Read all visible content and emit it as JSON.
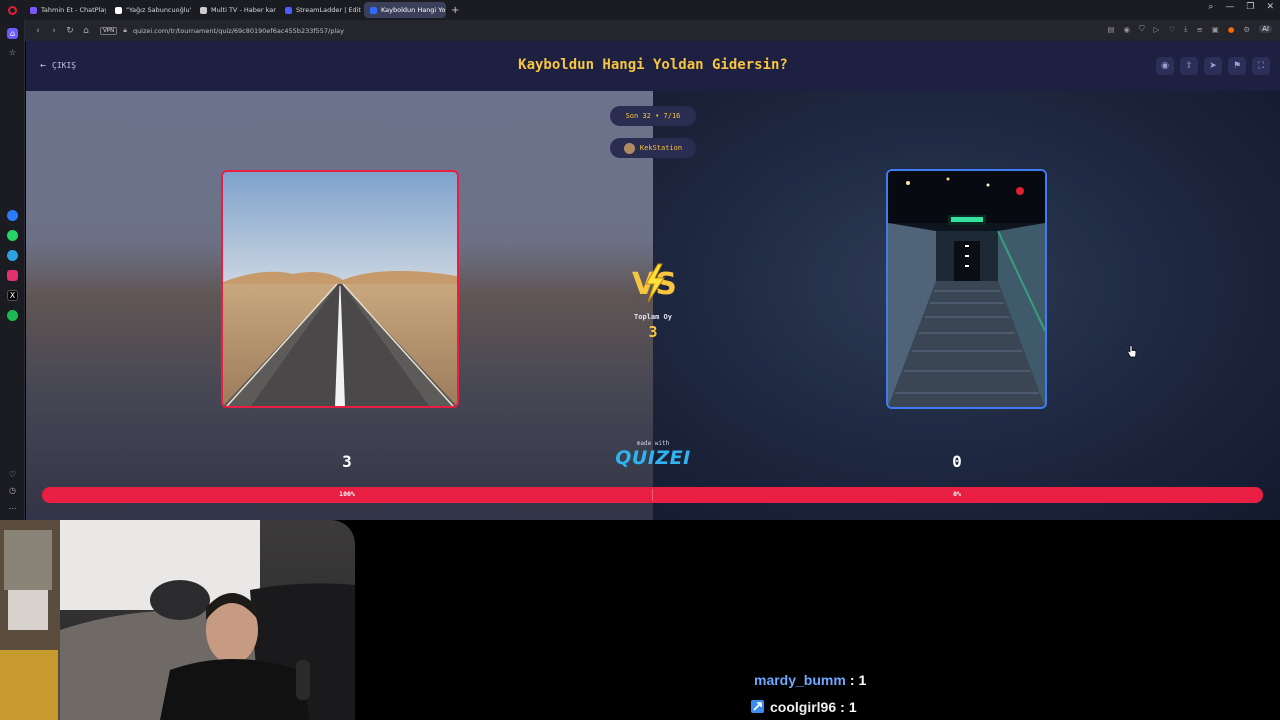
{
  "browser": {
    "tabs": [
      {
        "label": "Tahmin Et - ChatPlay",
        "color": "#7b57ff",
        "active": false
      },
      {
        "label": "\"Yağız Sabuncuoğlu\" - A…",
        "color": "#ffffff",
        "active": false
      },
      {
        "label": "Multi TV - Haber kanalla…",
        "color": "#cccccc",
        "active": false
      },
      {
        "label": "StreamLadder | Edit Twitc…",
        "color": "#4b5cff",
        "active": false
      },
      {
        "label": "Kayboldun Hangi Yoldan…",
        "color": "#2f6bff",
        "active": true
      }
    ],
    "vpn_label": "VPN",
    "url": "quizei.com/tr/tournament/quiz/69c80190ef6ac455b233f557/play",
    "ai_label": "AI"
  },
  "sidebar_icons": [
    "home-icon",
    "star-icon",
    "messenger-icon",
    "whatsapp-icon",
    "telegram-icon",
    "instagram-icon",
    "x-icon",
    "spotify-icon",
    "heart-icon",
    "history-icon",
    "more-icon"
  ],
  "header": {
    "exit_label": "ÇIKIŞ",
    "title": "Kayboldun Hangi Yoldan Gidersin?",
    "icons": [
      "eye-icon",
      "share-icon",
      "send-icon",
      "flag-icon",
      "fullscreen-icon"
    ]
  },
  "round": {
    "stage": "Son 32 • 7/16",
    "user": "KekStation"
  },
  "vs": {
    "text": "VS",
    "total_label": "Toplam Oy",
    "total_votes": "3"
  },
  "options": [
    {
      "votes": "3",
      "percent_label": "100%",
      "share": 1.0,
      "image": "desert road"
    },
    {
      "votes": "0",
      "percent_label": "0%",
      "share": 0.0,
      "image": "underground stairs"
    }
  ],
  "brand": {
    "made_with": "made with",
    "logo": "QUIZEI"
  },
  "chat": [
    {
      "user": "mardy_bumm",
      "count": "1",
      "badge": false
    },
    {
      "user": "coolgirl96",
      "count": "1",
      "badge": true
    }
  ]
}
